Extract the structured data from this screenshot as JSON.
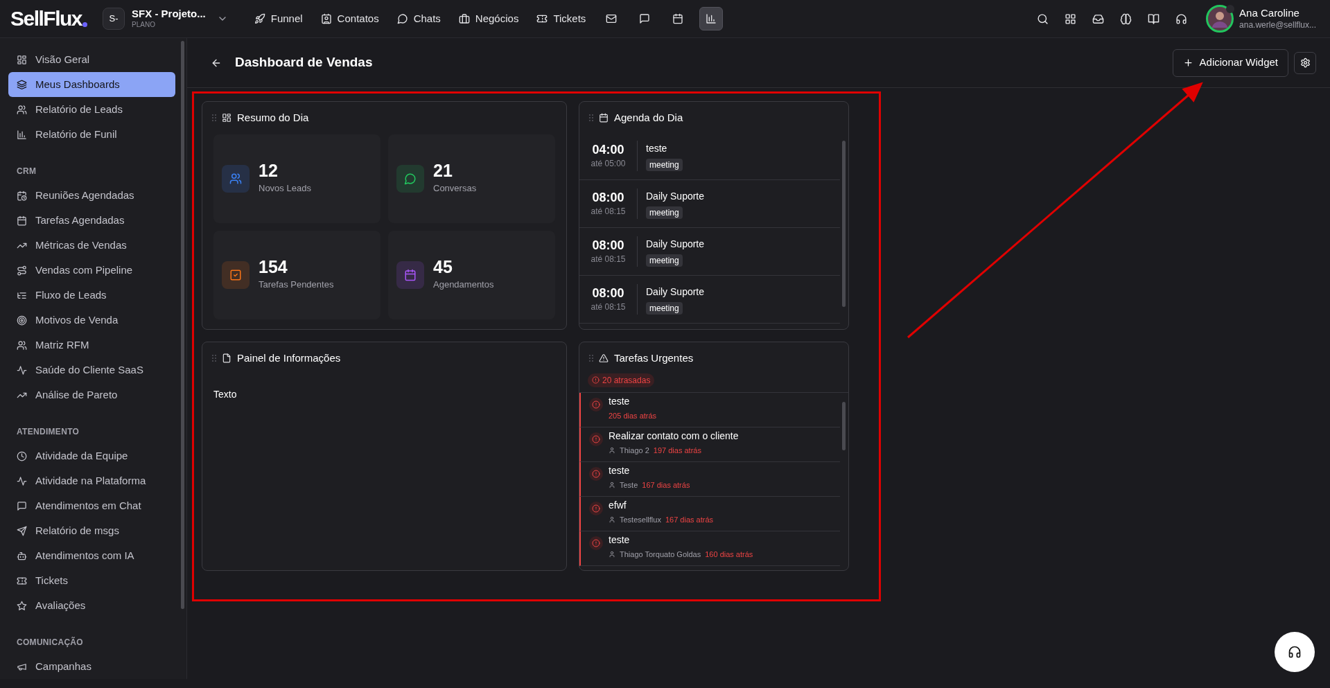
{
  "topbar": {
    "logo": "SellFlux",
    "workspace": {
      "initials": "S-",
      "name": "SFX - Projeto...",
      "plan": "PLANO"
    },
    "nav": [
      {
        "label": "Funnel"
      },
      {
        "label": "Contatos"
      },
      {
        "label": "Chats"
      },
      {
        "label": "Negócios"
      },
      {
        "label": "Tickets"
      }
    ],
    "icon_buttons": [
      {
        "selected": false
      },
      {
        "selected": false
      },
      {
        "selected": false
      },
      {
        "selected": true
      }
    ],
    "user": {
      "name": "Ana Caroline",
      "email": "ana.werle@sellflux..."
    }
  },
  "sidebar": {
    "sections": [
      {
        "items": [
          {
            "label": "Visão Geral",
            "selected": false
          },
          {
            "label": "Meus Dashboards",
            "selected": true
          },
          {
            "label": "Relatório de Leads",
            "selected": false
          },
          {
            "label": "Relatório de Funil",
            "selected": false
          }
        ]
      },
      {
        "title": "CRM",
        "items": [
          {
            "label": "Reuniões Agendadas",
            "selected": false
          },
          {
            "label": "Tarefas Agendadas",
            "selected": false
          },
          {
            "label": "Métricas de Vendas",
            "selected": false
          },
          {
            "label": "Vendas com Pipeline",
            "selected": false
          },
          {
            "label": "Fluxo de Leads",
            "selected": false
          },
          {
            "label": "Motivos de Venda",
            "selected": false
          },
          {
            "label": "Matriz RFM",
            "selected": false
          },
          {
            "label": "Saúde do Cliente SaaS",
            "selected": false
          },
          {
            "label": "Análise de Pareto",
            "selected": false
          }
        ]
      },
      {
        "title": "ATENDIMENTO",
        "items": [
          {
            "label": "Atividade da Equipe",
            "selected": false
          },
          {
            "label": "Atividade na Plataforma",
            "selected": false
          },
          {
            "label": "Atendimentos em Chat",
            "selected": false
          },
          {
            "label": "Relatório de msgs",
            "selected": false
          },
          {
            "label": "Atendimentos com IA",
            "selected": false
          },
          {
            "label": "Tickets",
            "selected": false
          },
          {
            "label": "Avaliações",
            "selected": false
          }
        ]
      },
      {
        "title": "COMUNICAÇÃO",
        "items": [
          {
            "label": "Campanhas",
            "selected": false
          }
        ]
      }
    ]
  },
  "page": {
    "title": "Dashboard de Vendas",
    "add_button": "Adicionar Widget"
  },
  "widgets": {
    "summary": {
      "title": "Resumo do Dia",
      "stats": [
        {
          "value": "12",
          "label": "Novos Leads",
          "color": "#3b82f6"
        },
        {
          "value": "21",
          "label": "Conversas",
          "color": "#22c55e"
        },
        {
          "value": "154",
          "label": "Tarefas Pendentes",
          "color": "#f97316"
        },
        {
          "value": "45",
          "label": "Agendamentos",
          "color": "#a855f7"
        }
      ]
    },
    "agenda": {
      "title": "Agenda do Dia",
      "events": [
        {
          "time": "04:00",
          "until": "até 05:00",
          "title": "teste",
          "tag": "meeting"
        },
        {
          "time": "08:00",
          "until": "até 08:15",
          "title": "Daily Suporte",
          "tag": "meeting"
        },
        {
          "time": "08:00",
          "until": "até 08:15",
          "title": "Daily Suporte",
          "tag": "meeting"
        },
        {
          "time": "08:00",
          "until": "até 08:15",
          "title": "Daily Suporte",
          "tag": "meeting"
        }
      ]
    },
    "info": {
      "title": "Painel de Informações",
      "body": "Texto"
    },
    "urgent": {
      "title": "Tarefas Urgentes",
      "badge": "20 atrasadas",
      "tasks": [
        {
          "title": "teste",
          "age": "205 dias atrás"
        },
        {
          "title": "Realizar contato com o cliente",
          "assignee": "Thiago 2",
          "age": "197 dias atrás"
        },
        {
          "title": "teste",
          "assignee": "Teste",
          "age": "167 dias atrás"
        },
        {
          "title": "efwf",
          "assignee": "Testesellflux",
          "age": "167 dias atrás"
        },
        {
          "title": "teste",
          "assignee": "Thiago Torquato Goldas",
          "age": "160 dias atrás"
        }
      ]
    }
  }
}
